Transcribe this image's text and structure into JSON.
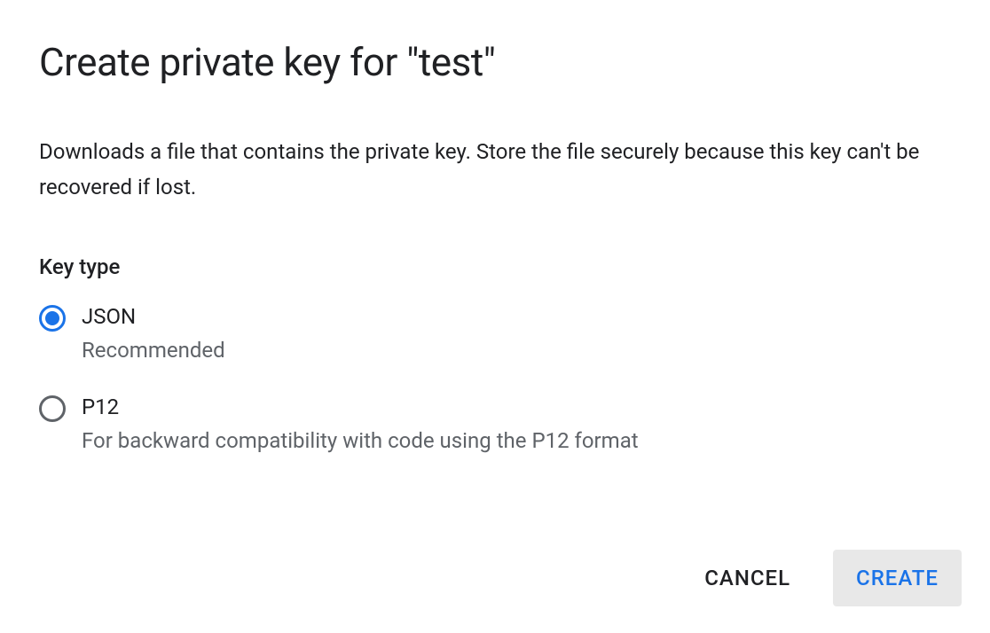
{
  "dialog": {
    "title": "Create private key for \"test\"",
    "description": "Downloads a file that contains the private key. Store the file securely because this key can't be recovered if lost.",
    "keyTypeLabel": "Key type",
    "options": {
      "json": {
        "label": "JSON",
        "hint": "Recommended",
        "selected": true
      },
      "p12": {
        "label": "P12",
        "hint": "For backward compatibility with code using the P12 format",
        "selected": false
      }
    },
    "actions": {
      "cancel": "CANCEL",
      "create": "CREATE"
    }
  }
}
